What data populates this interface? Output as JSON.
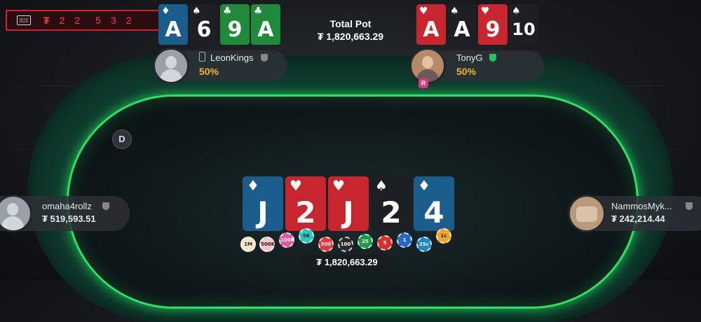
{
  "counter": {
    "ticket_icon": "ticket-icon",
    "currency": "₮",
    "digits": [
      "2",
      "2",
      "5",
      "3",
      "2"
    ]
  },
  "pot": {
    "label": "Total Pot",
    "amount": "₮ 1,820,663.29",
    "center_amount": "₮ 1,820,663.29"
  },
  "dealer_button": "D",
  "players": {
    "leon": {
      "name": "LeonKings",
      "equity": "50%",
      "device_icon": "mobile-phone-icon",
      "cards": [
        {
          "rank": "A",
          "suit": "♦",
          "color": "blue"
        },
        {
          "rank": "6",
          "suit": "♠",
          "color": "black"
        },
        {
          "rank": "9",
          "suit": "♣",
          "color": "green"
        },
        {
          "rank": "A",
          "suit": "♣",
          "color": "green"
        }
      ]
    },
    "tony": {
      "name": "TonyG",
      "equity": "50%",
      "badge": "R",
      "cards": [
        {
          "rank": "A",
          "suit": "♥",
          "color": "red"
        },
        {
          "rank": "A",
          "suit": "♠",
          "color": "black"
        },
        {
          "rank": "9",
          "suit": "♥",
          "color": "red"
        },
        {
          "rank": "10",
          "suit": "♠",
          "color": "black"
        }
      ]
    },
    "omaha": {
      "name": "omaha4rollz",
      "stack": "₮ 519,593.51"
    },
    "nammos": {
      "name": "NammosMyk...",
      "stack": "₮ 242,214.44"
    }
  },
  "board": [
    {
      "rank": "J",
      "suit": "♦",
      "color": "blue"
    },
    {
      "rank": "2",
      "suit": "♥",
      "color": "red"
    },
    {
      "rank": "J",
      "suit": "♥",
      "color": "red"
    },
    {
      "rank": "2",
      "suit": "♠",
      "color": "black"
    },
    {
      "rank": "4",
      "suit": "♦",
      "color": "blue"
    }
  ],
  "chips": [
    {
      "label": "1M",
      "color": "#f2e6c9"
    },
    {
      "label": "500K",
      "color": "#f3c7c7"
    },
    {
      "label": "100K",
      "color": "#e05a9b"
    },
    {
      "label": "5K",
      "color": "#2fc6c1"
    },
    {
      "label": "500",
      "color": "#e03a3a"
    },
    {
      "label": "100",
      "color": "#2a2a2a"
    },
    {
      "label": "25",
      "color": "#1f9a4a"
    },
    {
      "label": "5",
      "color": "#d72f2f"
    },
    {
      "label": "1",
      "color": "#2468c8"
    },
    {
      "label": "25c",
      "color": "#1d86c4"
    },
    {
      "label": "1c",
      "color": "#f2a424"
    }
  ],
  "colors": {
    "felt_glow": "#2ee06a",
    "equity": "#f5b623",
    "counter_red": "#d4202c"
  }
}
